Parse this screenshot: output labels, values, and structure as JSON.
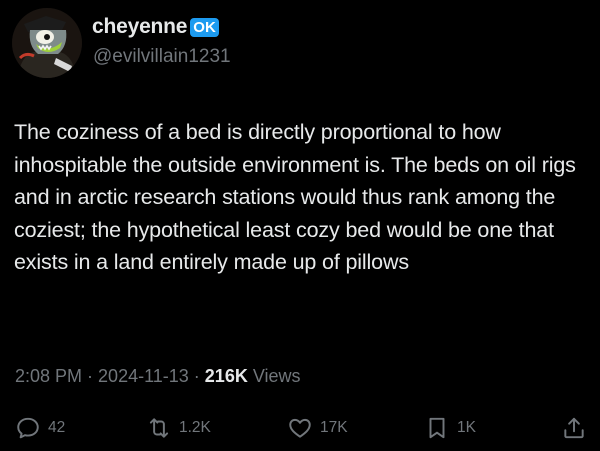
{
  "author": {
    "display_name": "cheyenne",
    "badge": "OK",
    "handle": "@evilvillain1231"
  },
  "tweet": {
    "text": "The coziness of a bed is directly proportional to how inhospitable the outside environment is. The beds on oil rigs and in arctic research stations would thus rank among the coziest; the hypothetical least cozy bed would be one that exists in a land entirely made up of pillows"
  },
  "meta": {
    "time": "2:08 PM",
    "separator": " · ",
    "date": "2024-11-13",
    "views_count": "216K",
    "views_label": " Views"
  },
  "actions": {
    "reply": {
      "icon": "reply-icon",
      "count": "42"
    },
    "repost": {
      "icon": "repost-icon",
      "count": "1.2K"
    },
    "like": {
      "icon": "heart-icon",
      "count": "17K"
    },
    "bookmark": {
      "icon": "bookmark-icon",
      "count": "1K"
    },
    "share": {
      "icon": "share-icon"
    }
  },
  "colors": {
    "background": "#000000",
    "primary_text": "#e7e9ea",
    "secondary_text": "#71767b",
    "badge": "#1d9bf0"
  }
}
